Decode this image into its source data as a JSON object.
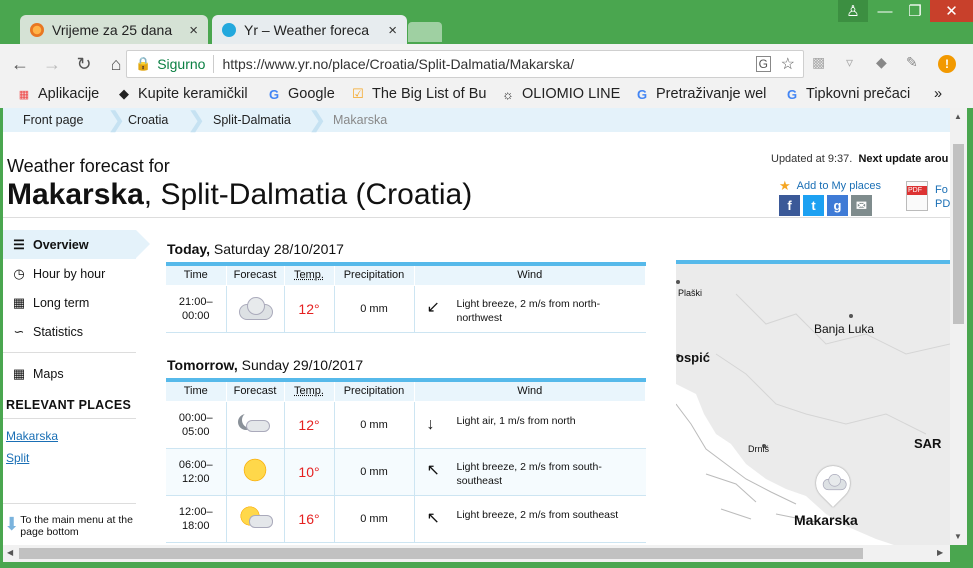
{
  "browser": {
    "tabs": [
      {
        "title": "Vrijeme za 25 dana",
        "active": false
      },
      {
        "title": "Yr – Weather foreca",
        "active": true
      }
    ],
    "close_symbol": "×",
    "omnibox": {
      "secure_label": "Sigurno",
      "url": "https://www.yr.no/place/Croatia/Split-Dalmatia/Makarska/"
    },
    "bookmarks": [
      {
        "label": "Aplikacije",
        "icon": "apps-grid-icon"
      },
      {
        "label": "Kupite keramičkil",
        "icon": "diamond-icon"
      },
      {
        "label": "Google",
        "icon": "google-icon"
      },
      {
        "label": "The Big List of Bu",
        "icon": "bookmark-icon"
      },
      {
        "label": "OLIOMIO LINE",
        "icon": "sun-icon"
      },
      {
        "label": "Pretraživanje wel",
        "icon": "google-icon"
      },
      {
        "label": "Tipkovni prečaci",
        "icon": "google-icon"
      }
    ],
    "bookmarks_more": "»"
  },
  "breadcrumb": [
    "Front page",
    "Croatia",
    "Split-Dalmatia",
    "Makarska"
  ],
  "header": {
    "pre_title": "Weather forecast for",
    "place_bold": "Makarska",
    "place_rest": ", Split-Dalmatia (Croatia)",
    "updated": "Updated at 9:37.",
    "next_update": "Next update arou",
    "add_places": "Add to My places",
    "pdf_label": "PDF",
    "pdf_text_1": "Fo",
    "pdf_text_2": "PD"
  },
  "nav": {
    "items": [
      {
        "label": "Overview",
        "icon": "list-icon",
        "active": true
      },
      {
        "label": "Hour by hour",
        "icon": "clock-icon"
      },
      {
        "label": "Long term",
        "icon": "calendar-icon"
      },
      {
        "label": "Statistics",
        "icon": "chart-icon"
      }
    ],
    "maps": "Maps",
    "relevant_heading": "RELEVANT PLACES",
    "relevant": [
      "Makarska",
      "Split"
    ],
    "to_main": "To the main menu at the page bottom"
  },
  "forecast": {
    "columns": [
      "Time",
      "Forecast",
      "Temp.",
      "Precipitation",
      "Wind"
    ],
    "days": [
      {
        "label_bold": "Today,",
        "label_rest": " Saturday 28/10/2017",
        "rows": [
          {
            "time1": "21:00–",
            "time2": "00:00",
            "icon": "cloudy-icon",
            "temp": "12°",
            "precip": "0 mm",
            "wind_arrow": "↙",
            "wind": "Light breeze, 2 m/s from north-northwest"
          }
        ]
      },
      {
        "label_bold": "Tomorrow,",
        "label_rest": " Sunday 29/10/2017",
        "rows": [
          {
            "time1": "00:00–",
            "time2": "05:00",
            "icon": "moon-cloud-icon",
            "temp": "12°",
            "precip": "0 mm",
            "wind_arrow": "↓",
            "wind": "Light air, 1 m/s from north"
          },
          {
            "time1": "06:00–",
            "time2": "12:00",
            "icon": "sun-icon",
            "temp": "10°",
            "precip": "0 mm",
            "wind_arrow": "↖",
            "wind": "Light breeze, 2 m/s from south-southeast"
          },
          {
            "time1": "12:00–",
            "time2": "18:00",
            "icon": "sun-cloud-icon",
            "temp": "16°",
            "precip": "0 mm",
            "wind_arrow": "↖",
            "wind": "Light breeze, 2 m/s from southeast"
          }
        ]
      }
    ]
  },
  "map": {
    "labels": [
      "Plaški",
      "Banja Luka",
      "ospić",
      "Drniš",
      "SAR",
      "Makarska"
    ]
  }
}
